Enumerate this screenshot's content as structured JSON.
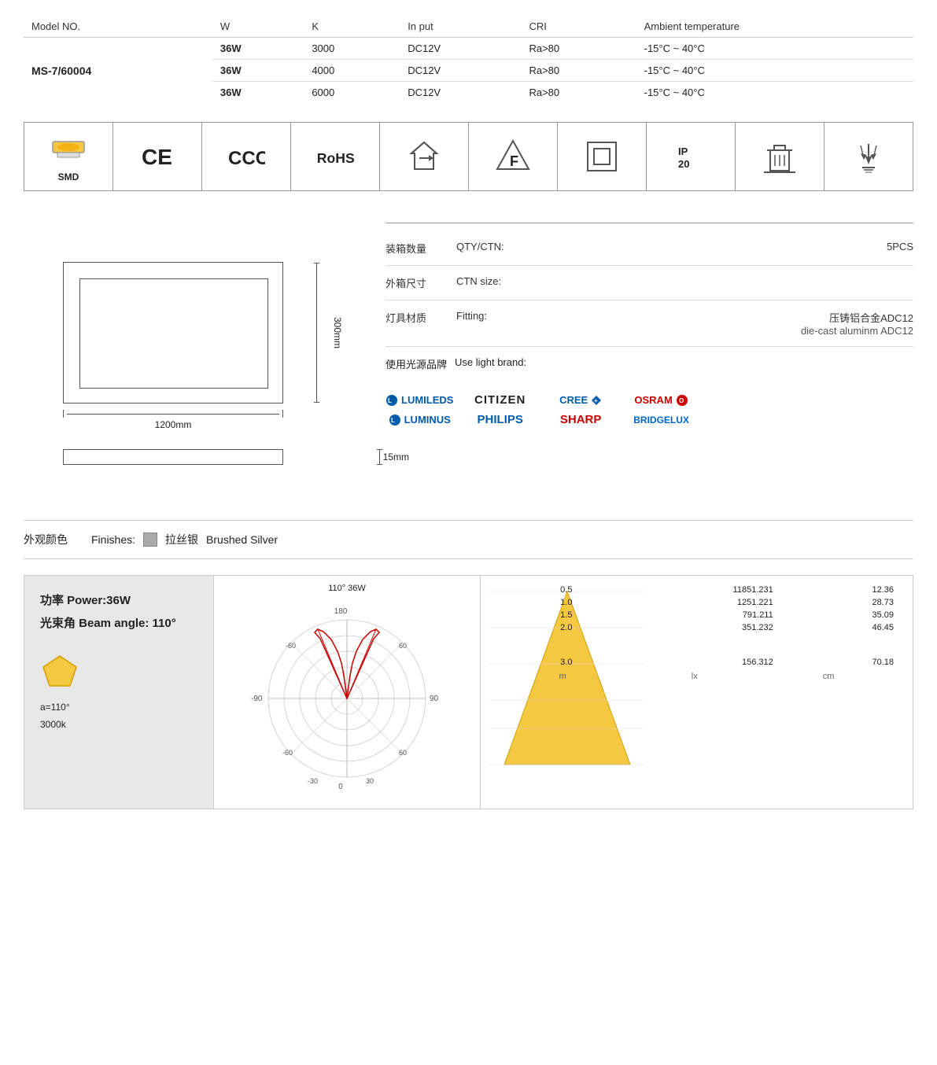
{
  "table": {
    "headers": [
      "Model NO.",
      "W",
      "K",
      "In put",
      "CRI",
      "Ambient temperature"
    ],
    "model": "MS-7/60004",
    "rows": [
      {
        "w": "36W",
        "k": "3000",
        "input": "DC12V",
        "cri": "Ra>80",
        "temp": "-15°C ~ 40°C"
      },
      {
        "w": "36W",
        "k": "4000",
        "input": "DC12V",
        "cri": "Ra>80",
        "temp": "-15°C ~ 40°C"
      },
      {
        "w": "36W",
        "k": "6000",
        "input": "DC12V",
        "cri": "Ra>80",
        "temp": "-15°C ~ 40°C"
      }
    ]
  },
  "symbols": [
    {
      "label": "SMD",
      "type": "smd"
    },
    {
      "label": "CE",
      "type": "ce"
    },
    {
      "label": "CCC",
      "type": "ccc"
    },
    {
      "label": "RoHS",
      "type": "rohs"
    },
    {
      "label": "",
      "type": "recycle"
    },
    {
      "label": "",
      "type": "flammability"
    },
    {
      "label": "",
      "type": "squarebox"
    },
    {
      "label": "IP\n20",
      "type": "ip20"
    },
    {
      "label": "",
      "type": "weee"
    },
    {
      "label": "",
      "type": "fragile"
    }
  ],
  "dims": {
    "width": "1200mm",
    "height": "300mm",
    "thickness": "15mm"
  },
  "info": {
    "qty_zh": "装箱数量",
    "qty_en": "QTY/CTN:",
    "qty_val": "5PCS",
    "ctn_zh": "外箱尺寸",
    "ctn_en": "CTN size:",
    "fitting_zh": "灯具材质",
    "fitting_en": "Fitting:",
    "fitting_val_zh": "压铸铝合金ADC12",
    "fitting_val_en": "die-cast aluminm ADC12",
    "brand_zh": "使用光源品牌",
    "brand_en": "Use light brand:"
  },
  "brands": [
    {
      "name": "LUMILEDS",
      "style": "lumileds"
    },
    {
      "name": "CITIZEN",
      "style": "citizen"
    },
    {
      "name": "CREE",
      "style": "cree"
    },
    {
      "name": "OSRAM",
      "style": "osram"
    },
    {
      "name": "LUMINUS",
      "style": "luminus"
    },
    {
      "name": "PHILIPS",
      "style": "philips"
    },
    {
      "name": "SHARP",
      "style": "sharp"
    },
    {
      "name": "BRIDGELUX",
      "style": "bridgelux"
    }
  ],
  "finish": {
    "label_zh": "外观颜色",
    "label_en": "Finishes:",
    "color": "#aaaaaa",
    "name_zh": "拉丝银",
    "name_en": "Brushed Silver"
  },
  "power": {
    "label": "功率 Power:36W",
    "beam": "光束角 Beam angle: 110°",
    "angle": "a=110°",
    "kelvin": "3000k"
  },
  "polar": {
    "title": "110°  36W",
    "labels": {
      "top": "180",
      "right": "90",
      "bottom": "0",
      "left": "-90",
      "r60": "60",
      "r30": "30",
      "rm30": "-30",
      "rm60": "-60"
    }
  },
  "photometry": {
    "rows": [
      {
        "m": "0.5",
        "lx": "11851.231",
        "cm": "12.36"
      },
      {
        "m": "1.0",
        "lx": "1251.221",
        "cm": "28.73"
      },
      {
        "m": "1.5",
        "lx": "791.211",
        "cm": "35.09"
      },
      {
        "m": "2.0",
        "lx": "351.232",
        "cm": "46.45"
      },
      {
        "m": "3.0",
        "lx": "156.312",
        "cm": "70.18"
      }
    ],
    "col_m": "m",
    "col_lx": "lx",
    "col_cm": "cm"
  }
}
